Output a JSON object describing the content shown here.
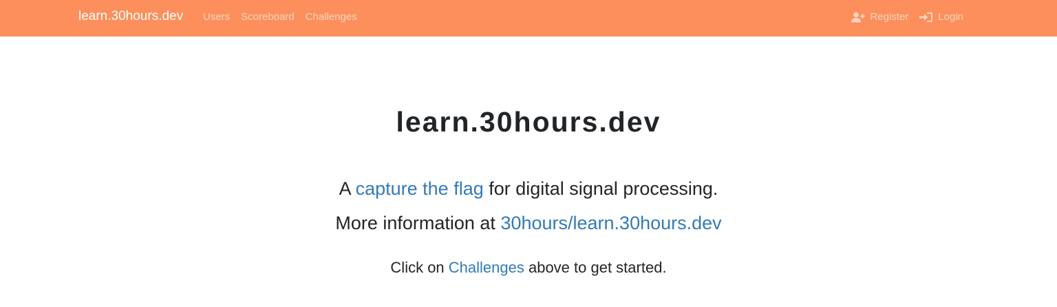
{
  "navbar": {
    "brand": "learn.30hours.dev",
    "links": [
      "Users",
      "Scoreboard",
      "Challenges"
    ],
    "register_label": "Register",
    "login_label": "Login",
    "background_color": "#fc8f5b"
  },
  "main": {
    "title": "learn.30hours.dev",
    "line1": {
      "prefix": "A ",
      "link": "capture the flag",
      "suffix": " for digital signal processing."
    },
    "line2": {
      "prefix": "More information at ",
      "link": "30hours/learn.30hours.dev"
    },
    "line3": {
      "prefix": "Click on ",
      "link": "Challenges",
      "suffix": " above to get started."
    },
    "link_color": "#337ab7"
  }
}
